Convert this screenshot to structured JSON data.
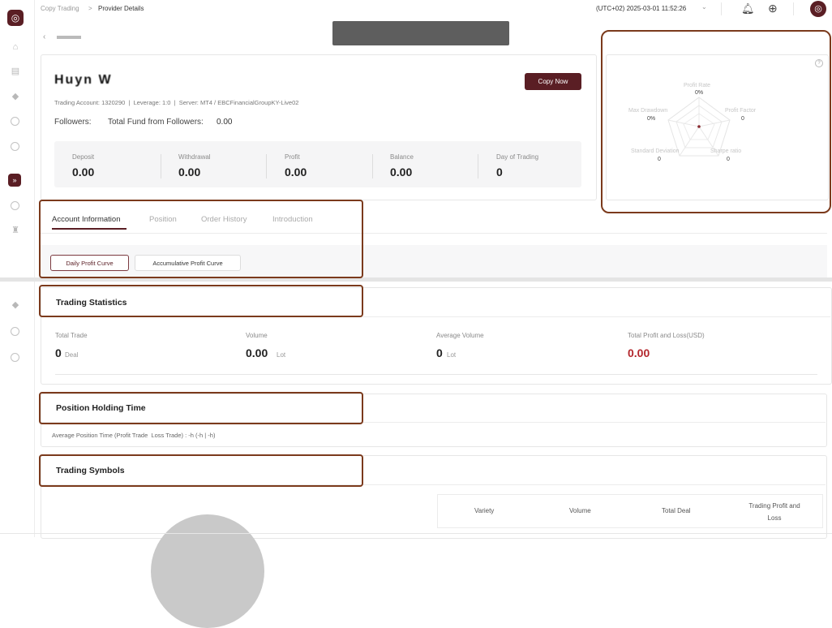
{
  "topbar": {
    "breadcrumb_root": "Copy Trading",
    "breadcrumb_sep": ">",
    "breadcrumb_current": "Provider Details",
    "datetime": "(UTC+02) 2025-03-01 11:52:26"
  },
  "provider": {
    "name": "Huyn W",
    "account_line": "Trading Account: 1320290  |  Leverage: 1:0  |  Server: MT4 / EBCFinancialGroupKY-Live02",
    "followers_label": "Followers:",
    "fund_label": "Total Fund from Followers:",
    "fund_value": "0.00",
    "copy_button": "Copy Now"
  },
  "stats": [
    {
      "label": "Deposit",
      "value": "0.00"
    },
    {
      "label": "Withdrawal",
      "value": "0.00"
    },
    {
      "label": "Profit",
      "value": "0.00"
    },
    {
      "label": "Balance",
      "value": "0.00"
    },
    {
      "label": "Day of Trading",
      "value": "0"
    }
  ],
  "radar": {
    "profit_rate": {
      "label": "Profit Rate",
      "value": "0%"
    },
    "profit_factor": {
      "label": "Profit Factor",
      "value": "0"
    },
    "sharpe_ratio": {
      "label": "Sharpe ratio",
      "value": "0"
    },
    "standard_deviation": {
      "label": "Standard Deviation",
      "value": "0"
    },
    "max_drawdown": {
      "label": "Max Drawdown",
      "value": "0%"
    },
    "help_icon": "question-icon"
  },
  "tabs": [
    "Account Information",
    "Position",
    "Order History",
    "Introduction"
  ],
  "curve_buttons": {
    "daily": "Daily Profit Curve",
    "accumulative": "Accumulative Profit Curve"
  },
  "trading_statistics": {
    "title": "Trading Statistics",
    "items": [
      {
        "label": "Total Trade",
        "value": "0",
        "unit": "Deal"
      },
      {
        "label": "Volume",
        "value": "0.00",
        "unit": "Lot"
      },
      {
        "label": "Average Volume",
        "value": "0",
        "unit": "Lot"
      },
      {
        "label": "Total Profit and Loss(USD)",
        "value": "0.00",
        "unit": ""
      }
    ]
  },
  "position_holding": {
    "title": "Position Holding Time",
    "text": "Average Position Time (Profit Trade  Loss Trade) : -h (-h | -h)"
  },
  "trading_symbols": {
    "title": "Trading Symbols",
    "columns": [
      "Variety",
      "Volume",
      "Total Deal",
      "Trading Profit and Loss"
    ]
  },
  "colors": {
    "brand": "#5a1e24",
    "annotation": "#7b3a1c",
    "loss_red": "#b3262c"
  }
}
